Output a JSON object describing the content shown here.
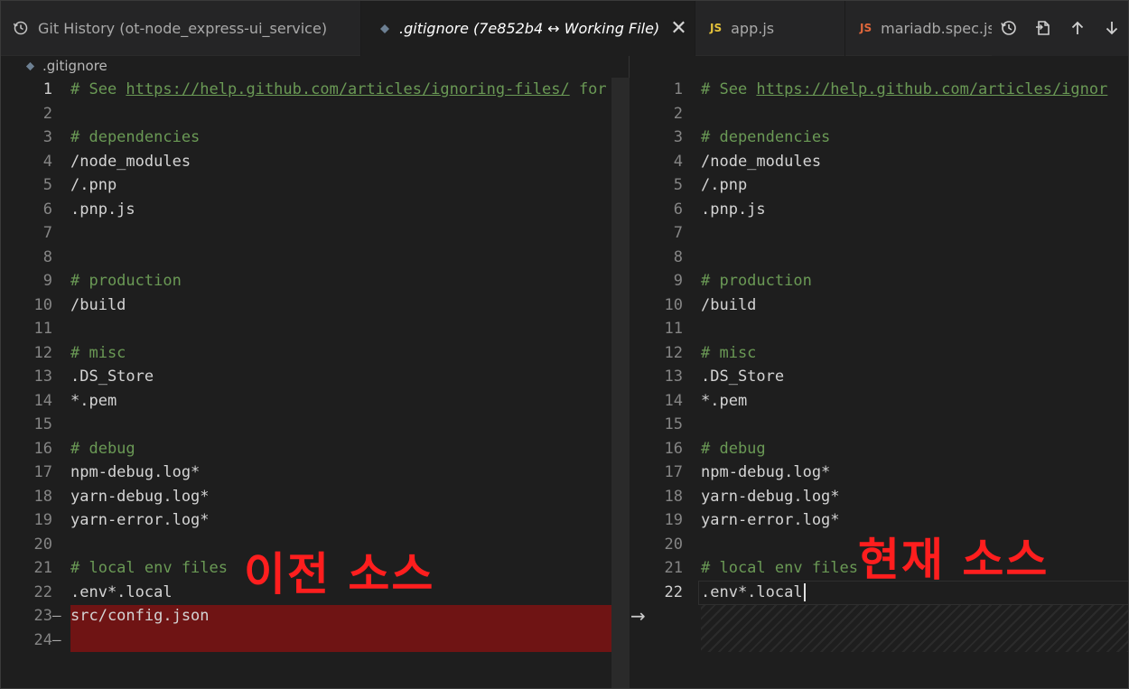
{
  "tabs": {
    "history": {
      "label": "Git History (ot-node_express-ui_service)"
    },
    "active": {
      "label": ".gitignore (7e852b4 ↔ Working File)",
      "close": "✕"
    },
    "app": {
      "badge": "JS",
      "label": "app.js"
    },
    "maria": {
      "badge": "JS",
      "label": "mariadb.spec.js"
    }
  },
  "breadcrumb": {
    "file": ".gitignore"
  },
  "colors": {
    "removed_bg": "#6f1414",
    "comment": "#6a9955",
    "annotation": "#ff1e1e",
    "js_yellow": "#e3c13b",
    "js_orange": "#e0673b"
  },
  "left_editor": {
    "lines": [
      {
        "n": "1",
        "cur": true,
        "parts": [
          {
            "t": "# See ",
            "c": "cmt"
          },
          {
            "t": "https://help.github.com/articles/ignoring-files/",
            "c": "link"
          },
          {
            "t": " for",
            "c": "cmt"
          }
        ]
      },
      {
        "n": "2",
        "parts": []
      },
      {
        "n": "3",
        "parts": [
          {
            "t": "# dependencies",
            "c": "cmt"
          }
        ]
      },
      {
        "n": "4",
        "parts": [
          {
            "t": "/node_modules"
          }
        ]
      },
      {
        "n": "5",
        "parts": [
          {
            "t": "/.pnp"
          }
        ]
      },
      {
        "n": "6",
        "parts": [
          {
            "t": ".pnp.js"
          }
        ]
      },
      {
        "n": "7",
        "parts": []
      },
      {
        "n": "8",
        "parts": []
      },
      {
        "n": "9",
        "parts": [
          {
            "t": "# production",
            "c": "cmt"
          }
        ]
      },
      {
        "n": "10",
        "parts": [
          {
            "t": "/build"
          }
        ]
      },
      {
        "n": "11",
        "parts": []
      },
      {
        "n": "12",
        "parts": [
          {
            "t": "# misc",
            "c": "cmt"
          }
        ]
      },
      {
        "n": "13",
        "parts": [
          {
            "t": ".DS_Store"
          }
        ]
      },
      {
        "n": "14",
        "parts": [
          {
            "t": "*.pem"
          }
        ]
      },
      {
        "n": "15",
        "parts": []
      },
      {
        "n": "16",
        "parts": [
          {
            "t": "# debug",
            "c": "cmt"
          }
        ]
      },
      {
        "n": "17",
        "parts": [
          {
            "t": "npm-debug.log*"
          }
        ]
      },
      {
        "n": "18",
        "parts": [
          {
            "t": "yarn-debug.log*"
          }
        ]
      },
      {
        "n": "19",
        "parts": [
          {
            "t": "yarn-error.log*"
          }
        ]
      },
      {
        "n": "20",
        "parts": []
      },
      {
        "n": "21",
        "parts": [
          {
            "t": "# local env files",
            "c": "cmt"
          }
        ]
      },
      {
        "n": "22",
        "parts": [
          {
            "t": ".env*.local"
          }
        ]
      },
      {
        "n": "23",
        "marker": "—",
        "parts": [
          {
            "t": "src/config.json"
          }
        ]
      },
      {
        "n": "24",
        "marker": "—",
        "parts": []
      }
    ]
  },
  "right_editor": {
    "lines": [
      {
        "n": "1",
        "parts": [
          {
            "t": "# See ",
            "c": "cmt"
          },
          {
            "t": "https://help.github.com/articles/ignor",
            "c": "link"
          }
        ]
      },
      {
        "n": "2",
        "parts": []
      },
      {
        "n": "3",
        "parts": [
          {
            "t": "# dependencies",
            "c": "cmt"
          }
        ]
      },
      {
        "n": "4",
        "parts": [
          {
            "t": "/node_modules"
          }
        ]
      },
      {
        "n": "5",
        "parts": [
          {
            "t": "/.pnp"
          }
        ]
      },
      {
        "n": "6",
        "parts": [
          {
            "t": ".pnp.js"
          }
        ]
      },
      {
        "n": "7",
        "parts": []
      },
      {
        "n": "8",
        "parts": []
      },
      {
        "n": "9",
        "parts": [
          {
            "t": "# production",
            "c": "cmt"
          }
        ]
      },
      {
        "n": "10",
        "parts": [
          {
            "t": "/build"
          }
        ]
      },
      {
        "n": "11",
        "parts": []
      },
      {
        "n": "12",
        "parts": [
          {
            "t": "# misc",
            "c": "cmt"
          }
        ]
      },
      {
        "n": "13",
        "parts": [
          {
            "t": ".DS_Store"
          }
        ]
      },
      {
        "n": "14",
        "parts": [
          {
            "t": "*.pem"
          }
        ]
      },
      {
        "n": "15",
        "parts": []
      },
      {
        "n": "16",
        "parts": [
          {
            "t": "# debug",
            "c": "cmt"
          }
        ]
      },
      {
        "n": "17",
        "parts": [
          {
            "t": "npm-debug.log*"
          }
        ]
      },
      {
        "n": "18",
        "parts": [
          {
            "t": "yarn-debug.log*"
          }
        ]
      },
      {
        "n": "19",
        "parts": [
          {
            "t": "yarn-error.log*"
          }
        ]
      },
      {
        "n": "20",
        "parts": []
      },
      {
        "n": "21",
        "parts": [
          {
            "t": "# local env files",
            "c": "cmt"
          }
        ]
      },
      {
        "n": "22",
        "cur": true,
        "parts": [
          {
            "t": ".env*.local"
          }
        ]
      }
    ]
  },
  "diff_arrow": "→",
  "annotations": {
    "left": "이전 소스",
    "right": "현재 소스"
  }
}
